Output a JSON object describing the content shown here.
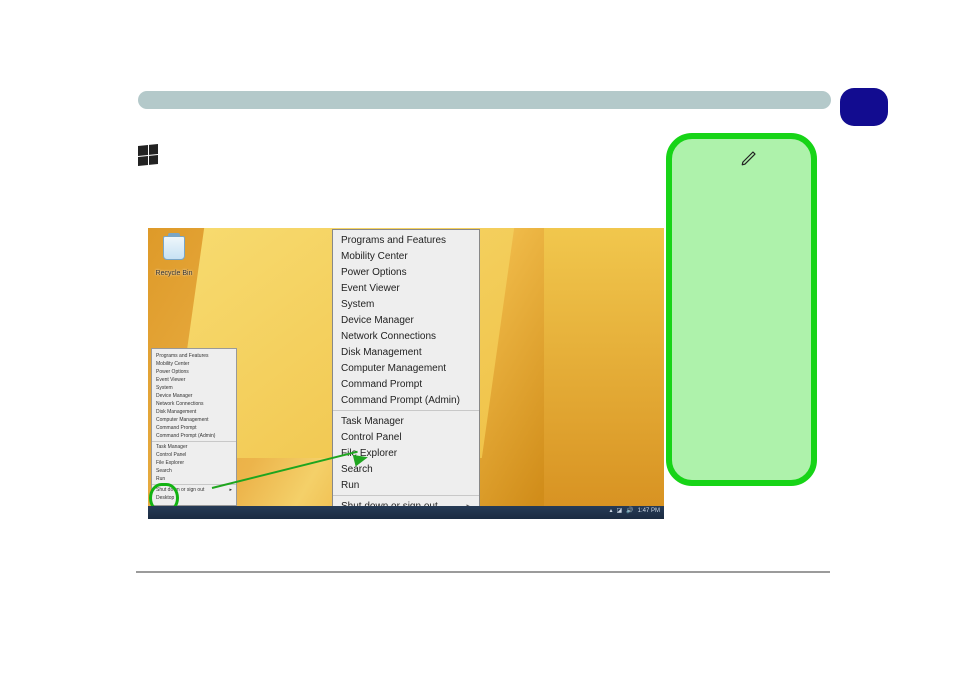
{
  "top_bar": {
    "color": "#b4c9ca"
  },
  "badge": {
    "color": "#120c90"
  },
  "recycle_label": "Recycle Bin",
  "winx_menu": {
    "group1": [
      "Programs and Features",
      "Mobility Center",
      "Power Options",
      "Event Viewer",
      "System",
      "Device Manager",
      "Network Connections",
      "Disk Management",
      "Computer Management",
      "Command Prompt",
      "Command Prompt (Admin)"
    ],
    "group2": [
      "Task Manager",
      "Control Panel",
      "File Explorer",
      "Search",
      "Run"
    ],
    "group3_submenu": "Shut down or sign out",
    "group3_selected": "Desktop"
  },
  "taskbar_time": "1:47 PM",
  "panel_icon": "pencil-icon"
}
